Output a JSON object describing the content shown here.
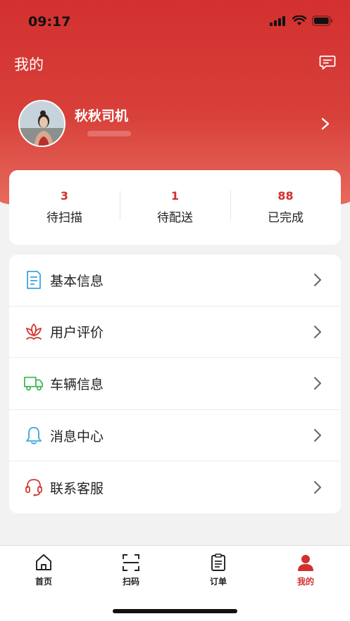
{
  "status_bar": {
    "time": "09:17"
  },
  "header": {
    "title": "我的"
  },
  "profile": {
    "name": "秋秋司机"
  },
  "stats": [
    {
      "value": "3",
      "label": "待扫描"
    },
    {
      "value": "1",
      "label": "待配送"
    },
    {
      "value": "88",
      "label": "已完成"
    }
  ],
  "menu": [
    {
      "label": "基本信息",
      "icon": "document-icon"
    },
    {
      "label": "用户评价",
      "icon": "lotus-icon"
    },
    {
      "label": "车辆信息",
      "icon": "truck-icon"
    },
    {
      "label": "消息中心",
      "icon": "bell-icon"
    },
    {
      "label": "联系客服",
      "icon": "headset-icon"
    }
  ],
  "tabbar": [
    {
      "label": "首页",
      "icon": "home-icon"
    },
    {
      "label": "扫码",
      "icon": "scan-icon"
    },
    {
      "label": "订单",
      "icon": "order-icon"
    },
    {
      "label": "我的",
      "icon": "user-icon",
      "active": true
    }
  ],
  "colors": {
    "brand": "#d22f2f",
    "menu_icon_blue": "#3ba6df",
    "menu_icon_green": "#39b54a"
  }
}
